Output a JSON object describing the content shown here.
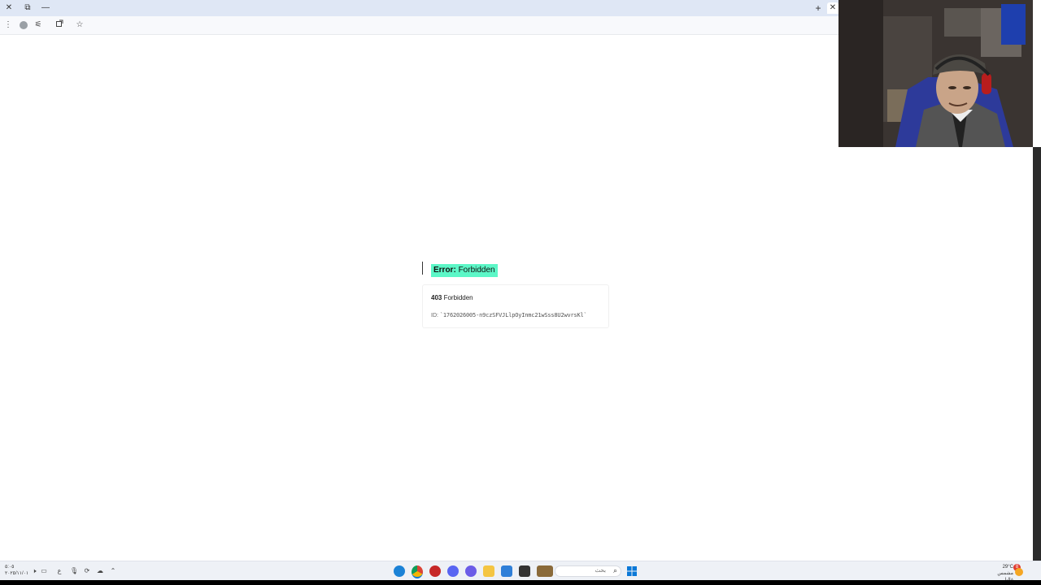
{
  "browser": {
    "window_controls": {
      "close": "✕",
      "restore": "⧉",
      "minimize": "—"
    },
    "new_tab": "+",
    "tab_close": "✕",
    "toolbar_icons": [
      "menu-icon",
      "info-icon",
      "extensions-icon",
      "share-icon",
      "bookmark-star-icon"
    ]
  },
  "page": {
    "error_label": "Error:",
    "error_message": "Forbidden",
    "status_code": "403",
    "status_text": "Forbidden",
    "id_label": "ID:",
    "id_value": "`1762026005-n9czSFVJLlpOyInmc21wSss8U2wvrsKl`"
  },
  "taskbar": {
    "clock_time": "٥:٠٥",
    "clock_date": "٢٠٢٥/١١/٠١",
    "search_placeholder": "بحث",
    "weather_temp": "29°C",
    "weather_desc": "مشمس غالبا",
    "notification_count": "8",
    "colors": {
      "accent": "#5cf7c7",
      "windows_blue": "#0a78d7"
    }
  }
}
